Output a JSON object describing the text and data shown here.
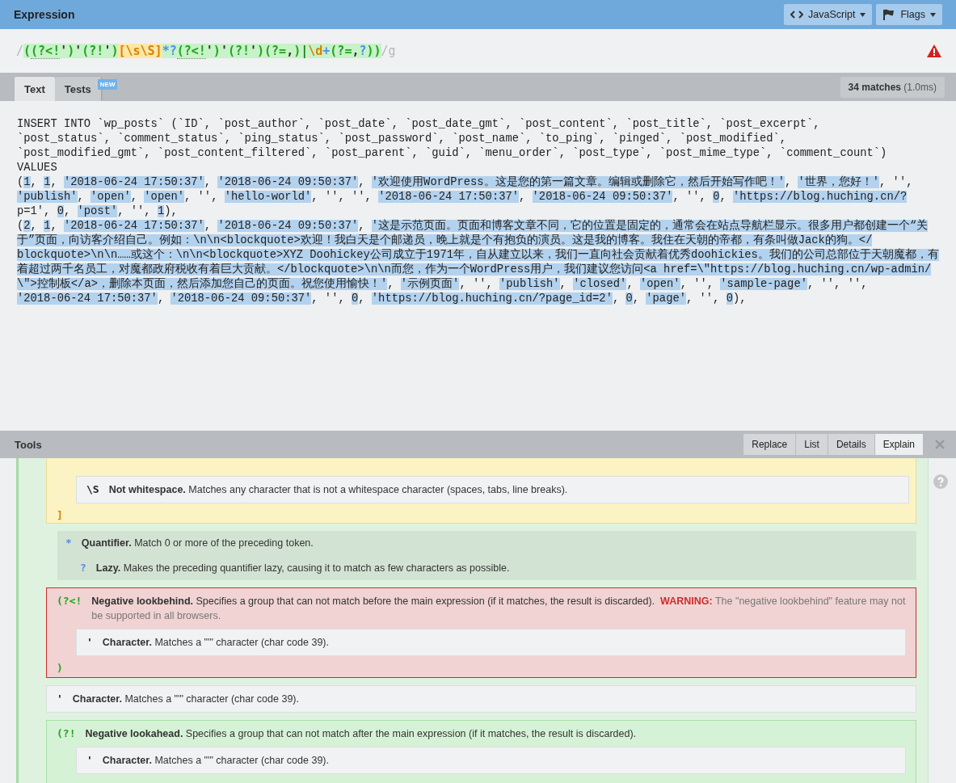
{
  "header": {
    "title": "Expression",
    "buttons": [
      {
        "kind": "code",
        "label": "JavaScript"
      },
      {
        "kind": "flag",
        "label": "Flags"
      }
    ]
  },
  "expression": {
    "tokens": [
      {
        "text": "/",
        "kind": "delim"
      },
      {
        "text": "(",
        "kind": "group"
      },
      {
        "text": "(?<!",
        "kind": "lookbehind"
      },
      {
        "text": "'",
        "kind": "char"
      },
      {
        "text": ")",
        "kind": "group"
      },
      {
        "text": "'",
        "kind": "char"
      },
      {
        "text": "(?!",
        "kind": "group"
      },
      {
        "text": "'",
        "kind": "char"
      },
      {
        "text": ")",
        "kind": "group"
      },
      {
        "text": "[\\s\\S]",
        "kind": "set"
      },
      {
        "text": "*?",
        "kind": "quant"
      },
      {
        "text": "(?<!",
        "kind": "lookbehind"
      },
      {
        "text": "'",
        "kind": "char"
      },
      {
        "text": ")",
        "kind": "group"
      },
      {
        "text": "'",
        "kind": "char"
      },
      {
        "text": "(?!",
        "kind": "group"
      },
      {
        "text": "'",
        "kind": "char"
      },
      {
        "text": ")",
        "kind": "group"
      },
      {
        "text": "(?=",
        "kind": "group"
      },
      {
        "text": ",",
        "kind": "char"
      },
      {
        "text": ")",
        "kind": "group"
      },
      {
        "text": "|",
        "kind": "alt"
      },
      {
        "text": "\\d",
        "kind": "escape"
      },
      {
        "text": "+",
        "kind": "quant"
      },
      {
        "text": "(?=",
        "kind": "group"
      },
      {
        "text": ",",
        "kind": "char"
      },
      {
        "text": "?",
        "kind": "quant"
      },
      {
        "text": ")",
        "kind": "group"
      },
      {
        "text": ")",
        "kind": "group"
      },
      {
        "text": "/g",
        "kind": "delim"
      }
    ],
    "warning": true
  },
  "tabs": [
    {
      "label": "Text",
      "selected": true
    },
    {
      "label": "Tests",
      "selected": false,
      "badge": "NEW"
    }
  ],
  "match_count": {
    "count": "34 matches",
    "time": "(1.0ms)"
  },
  "text_lines": [
    [
      {
        "text": "INSERT INTO `wp_posts` (`ID`, `post_author`, `post_date`, `post_date_gmt`, `post_content`, `post_title`, `post_excerpt`, ",
        "match": false
      }
    ],
    [
      {
        "text": "`post_status`, `comment_status`, `ping_status`, `post_password`, `post_name`, `to_ping`, `pinged`, `post_modified`, ",
        "match": false
      }
    ],
    [
      {
        "text": "`post_modified_gmt`, `post_content_filtered`, `post_parent`, `guid`, `menu_order`, `post_type`, `post_mime_type`, `comment_count`) ",
        "match": false
      }
    ],
    [
      {
        "text": "VALUES",
        "match": false
      }
    ],
    [
      {
        "text": "(",
        "match": false
      },
      {
        "text": "1",
        "match": true
      },
      {
        "text": ", ",
        "match": false
      },
      {
        "text": "1",
        "match": true
      },
      {
        "text": ", ",
        "match": false
      },
      {
        "text": "'2018-06-24 17:50:37'",
        "match": true
      },
      {
        "text": ", ",
        "match": false
      },
      {
        "text": "'2018-06-24 09:50:37'",
        "match": true
      },
      {
        "text": ", ",
        "match": false
      },
      {
        "text": "'欢迎使用WordPress。这是您的第一篇文章。编辑或删除它，然后开始写作吧！'",
        "match": true
      },
      {
        "text": ", ",
        "match": false
      },
      {
        "text": "'世界，您好！'",
        "match": true
      },
      {
        "text": ", '', ",
        "match": false
      }
    ],
    [
      {
        "text": "'publish'",
        "match": true
      },
      {
        "text": ", ",
        "match": false
      },
      {
        "text": "'open'",
        "match": true
      },
      {
        "text": ", ",
        "match": false
      },
      {
        "text": "'open'",
        "match": true
      },
      {
        "text": ", '', ",
        "match": false
      },
      {
        "text": "'hello-world'",
        "match": true
      },
      {
        "text": ", '', '', ",
        "match": false
      },
      {
        "text": "'2018-06-24 17:50:37'",
        "match": true
      },
      {
        "text": ", ",
        "match": false
      },
      {
        "text": "'2018-06-24 09:50:37'",
        "match": true
      },
      {
        "text": ", '', ",
        "match": false
      },
      {
        "text": "0",
        "match": true
      },
      {
        "text": ", ",
        "match": false
      },
      {
        "text": "'https://blog.huching.cn/?",
        "match": true
      }
    ],
    [
      {
        "text": "p=1', ",
        "match": false
      },
      {
        "text": "0",
        "match": true
      },
      {
        "text": ", ",
        "match": false
      },
      {
        "text": "'post'",
        "match": true
      },
      {
        "text": ", '', ",
        "match": false
      },
      {
        "text": "1",
        "match": true
      },
      {
        "text": "),",
        "match": false
      }
    ],
    [
      {
        "text": "(",
        "match": false
      },
      {
        "text": "2",
        "match": true
      },
      {
        "text": ", ",
        "match": false
      },
      {
        "text": "1",
        "match": true
      },
      {
        "text": ", ",
        "match": false
      },
      {
        "text": "'2018-06-24 17:50:37'",
        "match": true
      },
      {
        "text": ", ",
        "match": false
      },
      {
        "text": "'2018-06-24 09:50:37'",
        "match": true
      },
      {
        "text": ", ",
        "match": false
      },
      {
        "text": "'这是示范页面。页面和博客文章不同，它的位置是固定的，通常会在站点导航栏显示。很多用户都创建一个“关",
        "match": true
      }
    ],
    [
      {
        "text": "于”页面，向访客介绍自己。例如：\\n\\n<blockquote>欢迎！我白天是个邮递员，晚上就是个有抱负的演员。这是我的博客。我住在天朝的帝都，有条叫做Jack的狗。</",
        "match": true
      }
    ],
    [
      {
        "text": "blockquote>\\n\\n……或这个：\\n\\n<blockquote>XYZ Doohickey公司成立于1971年，自从建立以来，我们一直向社会贡献着优秀doohickies。我们的公司总部位于天朝魔都，有",
        "match": true
      }
    ],
    [
      {
        "text": "着超过两千名员工，对魔都政府税收有着巨大贡献。</blockquote>\\n\\n而您，作为一个WordPress用户，我们建议您访问<a href=\\\"https://blog.huching.cn/wp-admin/",
        "match": true
      }
    ],
    [
      {
        "text": "\\\">控制板</a>，删除本页面，然后添加您自己的页面。祝您使用愉快！'",
        "match": true
      },
      {
        "text": ", ",
        "match": false
      },
      {
        "text": "'示例页面'",
        "match": true
      },
      {
        "text": ", '', ",
        "match": false
      },
      {
        "text": "'publish'",
        "match": true
      },
      {
        "text": ", ",
        "match": false
      },
      {
        "text": "'closed'",
        "match": true
      },
      {
        "text": ", ",
        "match": false
      },
      {
        "text": "'open'",
        "match": true
      },
      {
        "text": ", '', ",
        "match": false
      },
      {
        "text": "'sample-page'",
        "match": true
      },
      {
        "text": ", '', '', ",
        "match": false
      }
    ],
    [
      {
        "text": "'2018-06-24 17:50:37'",
        "match": true
      },
      {
        "text": ", ",
        "match": false
      },
      {
        "text": "'2018-06-24 09:50:37'",
        "match": true
      },
      {
        "text": ", '', ",
        "match": false
      },
      {
        "text": "0",
        "match": true
      },
      {
        "text": ", ",
        "match": false
      },
      {
        "text": "'https://blog.huching.cn/?page_id=2'",
        "match": true
      },
      {
        "text": ", ",
        "match": false
      },
      {
        "text": "0",
        "match": true
      },
      {
        "text": ", ",
        "match": false
      },
      {
        "text": "'page'",
        "match": true
      },
      {
        "text": ", '', ",
        "match": false
      },
      {
        "text": "0",
        "match": true
      },
      {
        "text": "),",
        "match": false
      }
    ]
  ],
  "tools": {
    "title": "Tools",
    "tabs": [
      {
        "label": "Replace",
        "selected": false
      },
      {
        "label": "List",
        "selected": false
      },
      {
        "label": "Details",
        "selected": false
      },
      {
        "label": "Explain",
        "selected": true
      }
    ]
  },
  "explain": [
    {
      "kind": "set",
      "close": "]",
      "children": [
        {
          "kind": "char",
          "token": "\\S",
          "title": "Not whitespace.",
          "text": "Matches any character that is not a whitespace character (spaces, tabs, line breaks)."
        }
      ]
    },
    {
      "kind": "quant",
      "token": "*",
      "title": "Quantifier.",
      "text": "Match 0 or more of the preceding token.",
      "children": [
        {
          "kind": "quant",
          "token": "?",
          "title": "Lazy.",
          "text": "Makes the preceding quantifier lazy, causing it to match as few characters as possible."
        }
      ]
    },
    {
      "kind": "error",
      "token": "(?<!",
      "title": "Negative lookbehind.",
      "text": "Specifies a group that can not match before the main expression (if it matches, the result is discarded).",
      "warning_label": "WARNING:",
      "warning": "The \"negative lookbehind\" feature may not be supported in all browsers.",
      "close": ")",
      "children": [
        {
          "kind": "char",
          "token": "'",
          "title": "Character.",
          "text": "Matches a \"'\" character (char code 39)."
        }
      ]
    },
    {
      "kind": "char",
      "token": "'",
      "title": "Character.",
      "text": "Matches a \"'\" character (char code 39)."
    },
    {
      "kind": "group",
      "token": "(?!",
      "title": "Negative lookahead.",
      "text": "Specifies a group that can not match after the main expression (if it matches, the result is discarded).",
      "children": [
        {
          "kind": "char",
          "token": "'",
          "title": "Character.",
          "text": "Matches a \"'\" character (char code 39)."
        }
      ]
    }
  ]
}
